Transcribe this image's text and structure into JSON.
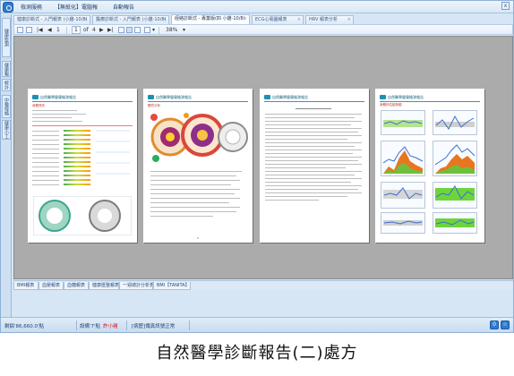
{
  "menu": {
    "items": [
      "檢測服務",
      "【無紙化】電腦報",
      "自動報告"
    ],
    "close_label": "x"
  },
  "left_rail": {
    "tabs": [
      "健康監測",
      "健康報告",
      "統計",
      "中醫經絡健康",
      "健康小工具"
    ]
  },
  "doc_tabs": [
    {
      "label": "健康診斷式 - 入門報表 (小雞-10/8)",
      "close": "×"
    },
    {
      "label": "醫療診斷式 - 入門報表 (小雞-10/8)",
      "close": "×"
    },
    {
      "label": "經絡診斷式 - 專業版(四 小雞-10/8)",
      "close": "×"
    },
    {
      "label": "ECG心電圖報表",
      "close": "×"
    },
    {
      "label": "HRV 報表分析",
      "close": "×"
    }
  ],
  "toolbar": {
    "page_current": "1",
    "page_of": "of",
    "page_total": "4",
    "zoom": "38%",
    "nav_first": "|◀",
    "nav_prev": "◀",
    "nav_next": "▶",
    "nav_last": "▶|"
  },
  "pages": [
    {
      "header": "自然醫學健康檢測報告",
      "section": "身體資訊",
      "page_no": "1"
    },
    {
      "header": "自然醫學健康檢測報告",
      "section": "體質分析",
      "page_no": "2"
    },
    {
      "header": "自然醫學健康檢測報告",
      "section": "",
      "page_no": "3"
    },
    {
      "header": "自然醫學健康檢測報告",
      "section": "身體評估趨勢圖",
      "page_no": "4"
    }
  ],
  "bottom_tabs": [
    "BMI報表",
    "血壓報表",
    "血糖報表",
    "健康匯整報表",
    "一週總計分析表",
    "BMI【TANITA】"
  ],
  "status": {
    "left": "剩餘'86,660.0'點",
    "left2": "設備'7'點",
    "left3": "許小雞",
    "middle": "[病歷]傳真訊號正常",
    "btn1": "0",
    "btn2": "☆"
  },
  "caption": "自然醫學診斷報告(二)處方"
}
